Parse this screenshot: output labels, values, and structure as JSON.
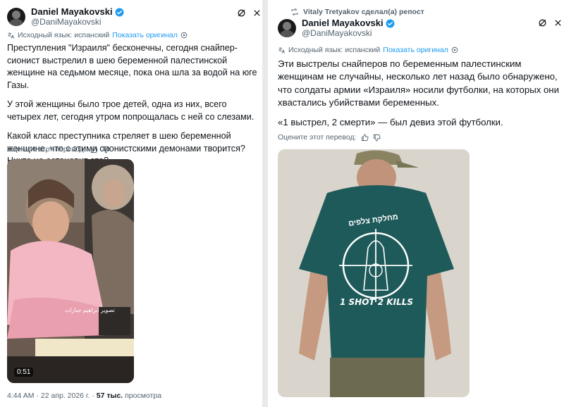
{
  "left_post": {
    "author": {
      "name": "Daniel Mayakovski",
      "handle": "@DaniMayakovski"
    },
    "source_language": "Исходный язык: испанский",
    "show_original": "Показать оригинал",
    "paragraphs": [
      "Преступления \"Израиля\" бесконечны, сегодня снайпер-сионист выстрелил в шею беременной палестинской женщине на седьмом месяце, пока она шла за водой на юге Газы.",
      "У этой женщины было трое детей, одна из них, всего четырех лет, сегодня утром попрощалась с ней со слезами.",
      "Какой класс преступника стреляет в шею беременной женщине, что с этими сионистскими демонами творится? Никто не остановит это?"
    ],
    "rate_translation": "Оцените этот перевод:",
    "video": {
      "duration": "0:51",
      "caption_arabic": "تصوير ابراهيم جبارات"
    },
    "meta": {
      "time_date": "4:44 AM · 22 апр. 2026 г. · ",
      "views_count": "57 тыс.",
      "views_label": " просмотра"
    }
  },
  "right_post": {
    "repost_label": "Vitaly Tretyakov сделал(а) репост",
    "author": {
      "name": "Daniel Mayakovski",
      "handle": "@DaniMayakovski"
    },
    "source_language": "Исходный язык: испанский",
    "show_original": "Показать оригинал",
    "paragraphs": [
      "Эти выстрелы снайперов по беременным палестинским женщинам не случайны, несколько лет назад было обнаружено, что солдаты армии «Израиля» носили футболки, на которых они хвастались убийствами беременных.",
      "«1 выстрел, 2 смерти» — был девиз этой футболки."
    ],
    "rate_translation": "Оцените этот перевод:",
    "shirt_text": {
      "hebrew": "מחלקת צלפים",
      "slogan": "1 SHOT 2 KILLS"
    }
  },
  "colors": {
    "accent": "#1d9bf0",
    "secondary_text": "#536471",
    "shirt": "#1f5a5a"
  }
}
